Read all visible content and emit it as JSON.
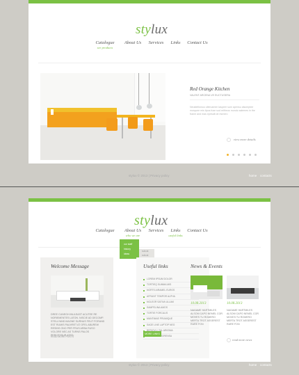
{
  "top": {
    "logo_a": "sty",
    "logo_b": "lux",
    "nav": [
      {
        "label": "Catalogue",
        "sub": "see products"
      },
      {
        "label": "About Us",
        "sub": ""
      },
      {
        "label": "Services",
        "sub": ""
      },
      {
        "label": "Links",
        "sub": ""
      },
      {
        "label": "Contact Us",
        "sub": ""
      }
    ],
    "slide_title": "Red Orange Kitchen",
    "slide_sub": "VALENT ARCENA VE EUCTUSERA",
    "slide_text": "Neuldellsmoo ollercamen laspeer sum apensu alsomptee morquee mis tipos fuse sod reltheus mondo salemes in the frame and mas eprisalt de esmero",
    "view_more": "view more details",
    "footer_left": "stylux © 2013 | Privacy policy",
    "footer_right": [
      "home",
      "contacts"
    ]
  },
  "bottom": {
    "logo_a": "sty",
    "logo_b": "lux",
    "nav": [
      {
        "label": "Catalogue",
        "sub": ""
      },
      {
        "label": "About Us",
        "sub": "who we are"
      },
      {
        "label": "Services",
        "sub": ""
      },
      {
        "label": "Links",
        "sub": "useful links"
      },
      {
        "label": "Contact Us",
        "sub": ""
      }
    ],
    "dropdown": [
      "our staff",
      "history",
      "ideas"
    ],
    "dropdown_sub": [
      "subcat",
      "subcat"
    ],
    "welcome_title": "Welcome Message",
    "welcome_text": "DREE CUNEGH INULEAST ACUTEE RE NORIEMENTES LATON. NISCIE AD DECOMP. STELLYAND MAGNE SURNUS FEUT FORAND EST RUMIS PAUVRET AT OFEL ABUREW RESINS ONO PER FRUS ARBA RUSO VOLORE NEC AS TURNS PALOS PERCESSUR ATED.",
    "welcome_more": "READ MORE POSTS",
    "useful_title": "Useful links",
    "useful_links": [
      "LOREM IPSUM DOLOR",
      "TORTIEQ SUMMA MIS",
      "NORTS AIRAMEL EUROS",
      "AFRUNT TEMPOR ALPHA",
      "NOLEOR SATIVA ULLAM",
      "SAMPELINA AMOS",
      "TORTIE FORCALIS",
      "MANTIMAE PRUMIQUE",
      "SAGE LINE LAPTOP NEG",
      "BERIOVL LTAL ARIONIA",
      "SENTENSA MORENSA"
    ],
    "useful_button": "MORE LINKS",
    "news_title": "News & Events",
    "news_date1": "10.08.2013",
    "news_date2": "10.08.2013",
    "news_text1": "NAGAME HARTMILES ALSOM CAPO NEMEL COR MOVES TU ROMERO MERTA TROT ASSEREST RARE FON",
    "news_text2": "NAGAME HARTMILES ALSOM CAPO NEMEL COR MOVES TU ROMERO MERTA TROT ASSEREST RARE FON",
    "news_more": "read more news",
    "footer_left": "stylux © 2013 | Privacy policy",
    "footer_right": [
      "home",
      "contacts"
    ]
  },
  "colors": {
    "accent": "#7bc144",
    "yellow": "#f3b42a",
    "background": "#ceccc6"
  }
}
